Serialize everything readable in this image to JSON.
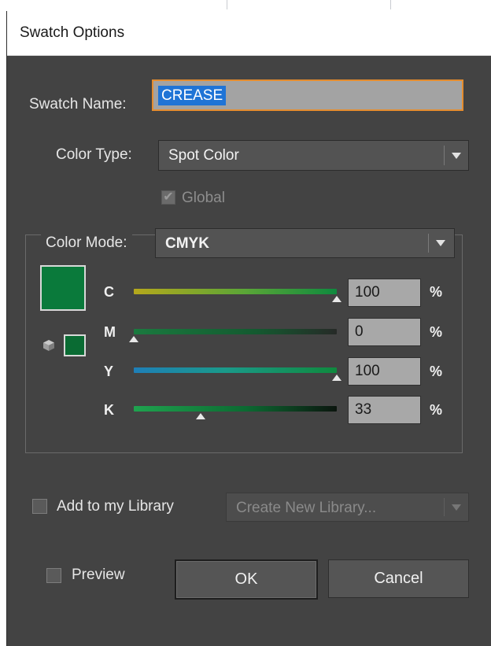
{
  "dialog": {
    "title": "Swatch Options"
  },
  "swatch_name": {
    "label": "Swatch Name:",
    "value": "CREASE"
  },
  "color_type": {
    "label": "Color Type:",
    "selected": "Spot Color"
  },
  "global": {
    "label": "Global",
    "checked": true,
    "enabled": false
  },
  "color_mode": {
    "label": "Color Mode:",
    "selected": "CMYK"
  },
  "swatch_preview": {
    "color": "#0a7a3b"
  },
  "channels": [
    {
      "label": "C",
      "value": "100",
      "unit": "%",
      "fraction": 1.0
    },
    {
      "label": "M",
      "value": "0",
      "unit": "%",
      "fraction": 0.0
    },
    {
      "label": "Y",
      "value": "100",
      "unit": "%",
      "fraction": 1.0
    },
    {
      "label": "K",
      "value": "33",
      "unit": "%",
      "fraction": 0.33
    }
  ],
  "library": {
    "label": "Add to my Library",
    "checked": false,
    "dropdown_placeholder": "Create New Library..."
  },
  "preview": {
    "label": "Preview",
    "checked": false
  },
  "buttons": {
    "ok": "OK",
    "cancel": "Cancel"
  }
}
